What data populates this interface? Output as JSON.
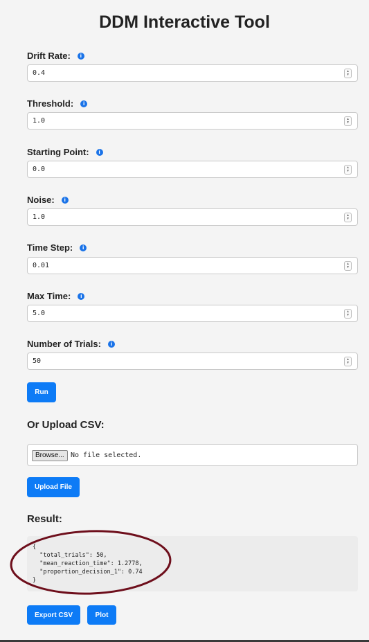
{
  "title": "DDM Interactive Tool",
  "info_glyph": "i",
  "spinner": {
    "up": "▲",
    "down": "▼"
  },
  "fields": [
    {
      "label": "Drift Rate:",
      "value": "0.4"
    },
    {
      "label": "Threshold:",
      "value": "1.0"
    },
    {
      "label": "Starting Point:",
      "value": "0.0"
    },
    {
      "label": "Noise:",
      "value": "1.0"
    },
    {
      "label": "Time Step:",
      "value": "0.01"
    },
    {
      "label": "Max Time:",
      "value": "5.0"
    },
    {
      "label": "Number of Trials:",
      "value": "50"
    }
  ],
  "run_button": "Run",
  "upload": {
    "heading": "Or Upload CSV:",
    "browse_label": "Browse...",
    "no_file_text": "No file selected.",
    "upload_button": "Upload File"
  },
  "result": {
    "heading": "Result:",
    "json_text": "{\n  \"total_trials\": 50,\n  \"mean_reaction_time\": 1.2778,\n  \"proportion_decision_1\": 0.74\n}"
  },
  "actions": {
    "export_button": "Export CSV",
    "plot_button": "Plot"
  },
  "colors": {
    "accent": "#0d7bf6",
    "annotation": "#6e0f1c",
    "background": "#f4f4f4"
  }
}
